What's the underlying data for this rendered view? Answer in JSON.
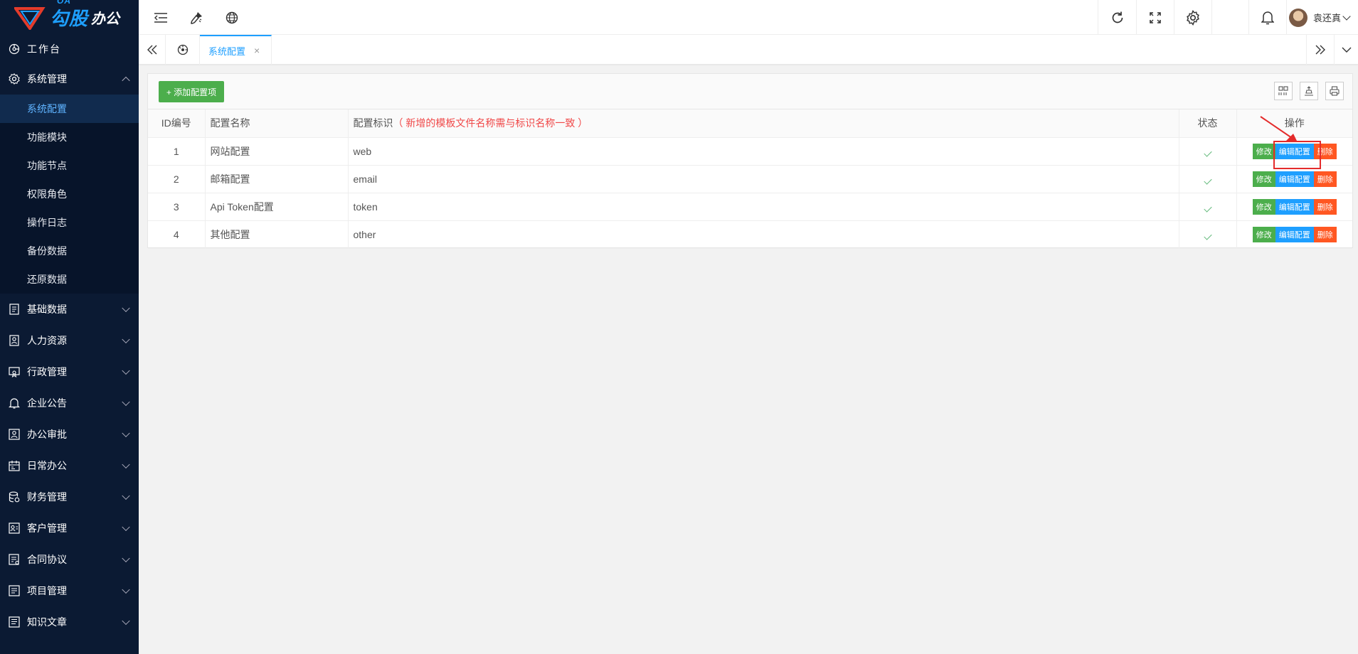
{
  "brand": {
    "oa": "OA",
    "name": "勾股",
    "sub": "办公"
  },
  "sidebar": {
    "workbench": "工作台",
    "system": {
      "label": "系统管理",
      "items": [
        "系统配置",
        "功能模块",
        "功能节点",
        "权限角色",
        "操作日志",
        "备份数据",
        "还原数据"
      ]
    },
    "groups": [
      "基础数据",
      "人力资源",
      "行政管理",
      "企业公告",
      "办公审批",
      "日常办公",
      "财务管理",
      "客户管理",
      "合同协议",
      "项目管理",
      "知识文章"
    ]
  },
  "header": {
    "user_name": "袁还真"
  },
  "tabs": {
    "active_label": "系统配置",
    "close": "×"
  },
  "toolbar": {
    "add_label": "+ 添加配置项"
  },
  "table": {
    "headers": {
      "id": "ID编号",
      "name": "配置名称",
      "key": "配置标识",
      "key_note": "（ 新增的模板文件名称需与标识名称一致 ）",
      "status": "状态",
      "ops": "操作"
    },
    "rows": [
      {
        "id": "1",
        "name": "网站配置",
        "key": "web"
      },
      {
        "id": "2",
        "name": "邮箱配置",
        "key": "email"
      },
      {
        "id": "3",
        "name": "Api Token配置",
        "key": "token"
      },
      {
        "id": "4",
        "name": "其他配置",
        "key": "other"
      }
    ],
    "op_labels": {
      "edit": "修改",
      "config": "编辑配置",
      "delete": "删除"
    }
  },
  "colors": {
    "sidebar_bg": "#0b1a33",
    "accent": "#1e9fff",
    "green": "#4cae4c",
    "orange": "#ff5722",
    "annotation": "#e42b2b"
  }
}
